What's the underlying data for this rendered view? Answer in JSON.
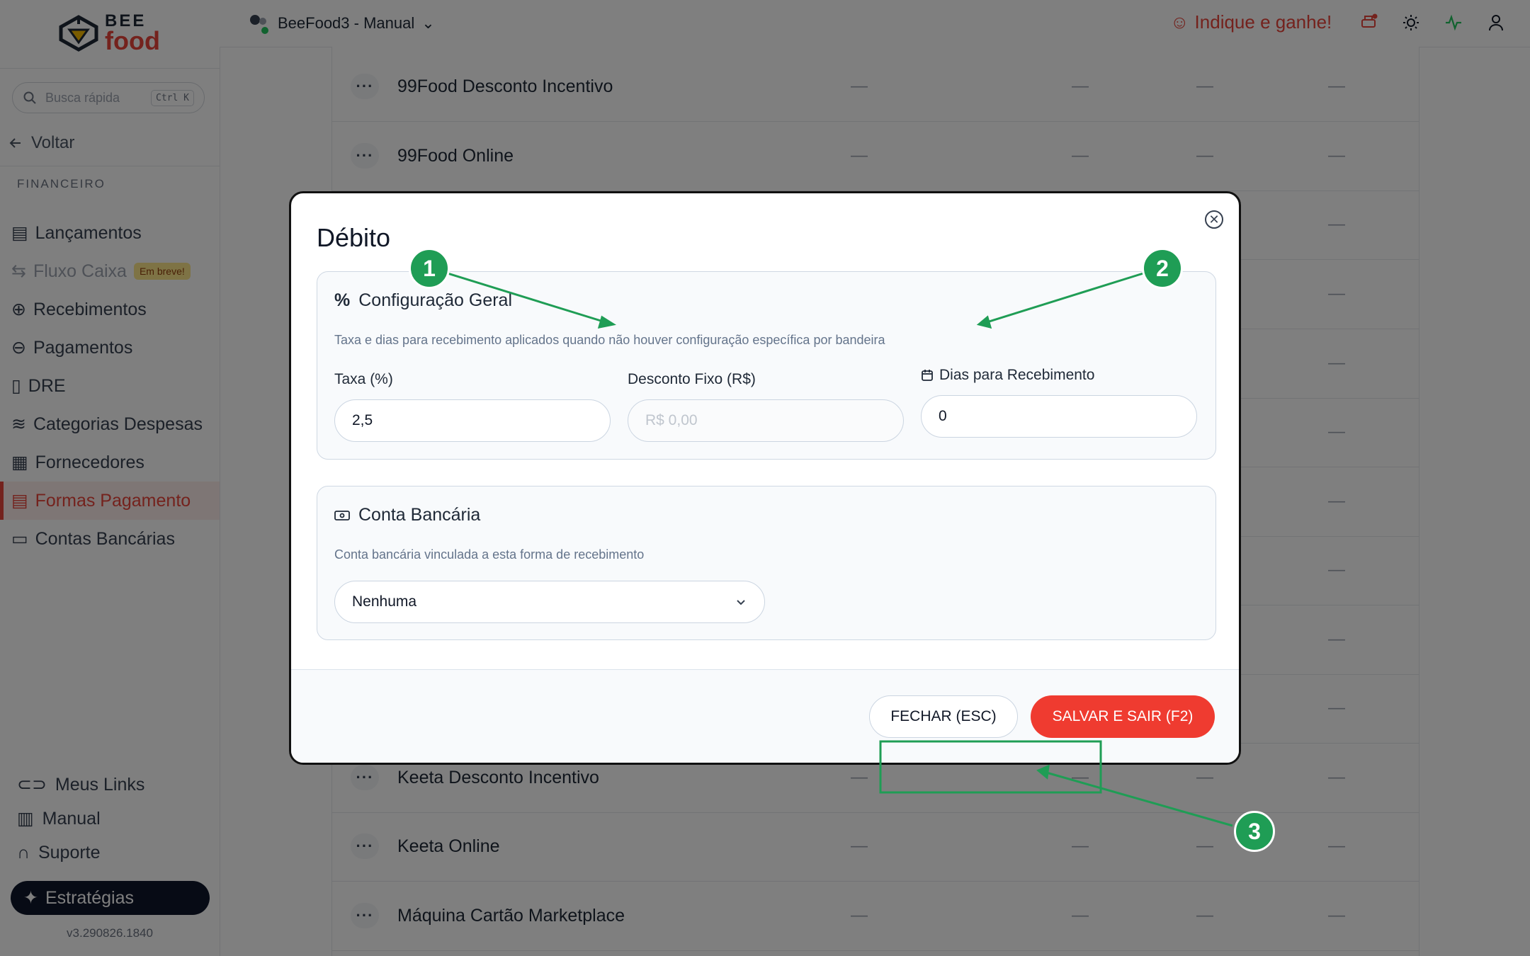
{
  "app": {
    "logo_top": "BEE",
    "logo_bottom": "food",
    "project_name": "BeeFood3 - Manual",
    "refer_label": "Indique e ganhe!",
    "version": "v3.290826.1840"
  },
  "search": {
    "placeholder": "Busca rápida",
    "shortcut": "Ctrl K"
  },
  "sidebar": {
    "back_label": "Voltar",
    "section_title": "FINANCEIRO",
    "items": [
      {
        "label": "Lançamentos",
        "icon": "dollar-doc-icon"
      },
      {
        "label": "Fluxo Caixa",
        "icon": "flow-icon",
        "badge": "Em breve!"
      },
      {
        "label": "Recebimentos",
        "icon": "arrow-up-circle-icon"
      },
      {
        "label": "Pagamentos",
        "icon": "arrow-down-circle-icon"
      },
      {
        "label": "DRE",
        "icon": "document-icon"
      },
      {
        "label": "Categorias Despesas",
        "icon": "layers-icon"
      },
      {
        "label": "Fornecedores",
        "icon": "building-icon"
      },
      {
        "label": "Formas Pagamento",
        "icon": "dollar-doc-icon",
        "active": true
      },
      {
        "label": "Contas Bancárias",
        "icon": "wallet-icon"
      }
    ],
    "bottom_items": [
      {
        "label": "Meus Links",
        "icon": "link-icon"
      },
      {
        "label": "Manual",
        "icon": "book-icon"
      },
      {
        "label": "Suporte",
        "icon": "headset-icon"
      }
    ],
    "strategies_label": "Estratégias"
  },
  "table": {
    "rows": [
      {
        "name": "99Food Desconto Incentivo",
        "cols": [
          "—",
          "—",
          "—",
          "—"
        ]
      },
      {
        "name": "99Food Online",
        "cols": [
          "—",
          "—",
          "—",
          "—"
        ]
      },
      {
        "name": "",
        "cols": [
          "",
          "",
          "",
          "—"
        ]
      },
      {
        "name": "",
        "cols": [
          "",
          "",
          "",
          "—"
        ]
      },
      {
        "name": "",
        "cols": [
          "",
          "",
          "",
          "—"
        ]
      },
      {
        "name": "",
        "cols": [
          "",
          "",
          "",
          "—"
        ]
      },
      {
        "name": "",
        "cols": [
          "",
          "",
          "",
          "—"
        ]
      },
      {
        "name": "",
        "cols": [
          "",
          "",
          "",
          "—"
        ]
      },
      {
        "name": "",
        "cols": [
          "",
          "",
          "",
          "—"
        ]
      },
      {
        "name": "",
        "cols": [
          "",
          "",
          "",
          "—"
        ]
      },
      {
        "name": "Keeta Desconto Incentivo",
        "cols": [
          "—",
          "—",
          "—",
          "—"
        ]
      },
      {
        "name": "Keeta Online",
        "cols": [
          "—",
          "—",
          "—",
          "—"
        ]
      },
      {
        "name": "Máquina Cartão Marketplace",
        "cols": [
          "—",
          "—",
          "—",
          "—"
        ]
      }
    ]
  },
  "modal": {
    "title": "Débito",
    "general": {
      "heading": "Configuração Geral",
      "description": "Taxa e dias para recebimento aplicados quando não houver configuração específica por bandeira",
      "fee_label": "Taxa (%)",
      "fee_value": "2,5",
      "discount_label": "Desconto Fixo (R$)",
      "discount_placeholder": "R$ 0,00",
      "days_label": "Dias para Recebimento",
      "days_value": "0"
    },
    "bank": {
      "heading": "Conta Bancária",
      "description": "Conta bancária vinculada a esta forma de recebimento",
      "selected": "Nenhuma"
    },
    "close_button": "FECHAR (ESC)",
    "save_button": "SALVAR E SAIR (F2)"
  },
  "annotations": {
    "badge1": "1",
    "badge2": "2",
    "badge3": "3"
  },
  "colors": {
    "brand": "#e8443a",
    "annotation": "#1f9d55",
    "save": "#ef3b30"
  }
}
